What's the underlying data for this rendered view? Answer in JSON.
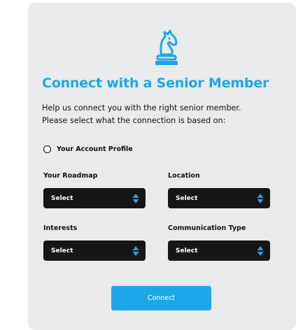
{
  "card": {
    "logo_icon": "chess-knight-icon",
    "title": "Connect with a Senior Member",
    "description_line1": "Help us connect you with the right senior member.",
    "description_line2": "Please select what the connection is based on:"
  },
  "option": {
    "label": "Your Account Profile",
    "selected": false
  },
  "fields": {
    "roadmap": {
      "label": "Your Roadmap",
      "value": "Select"
    },
    "location": {
      "label": "Location",
      "value": "Select"
    },
    "interests": {
      "label": "Interests",
      "value": "Select"
    },
    "communication": {
      "label": "Communication Type",
      "value": "Select"
    }
  },
  "button": {
    "label": "Connect"
  },
  "colors": {
    "accent": "#1ea7e8",
    "card_bg": "#e9eaec",
    "select_bg": "#161616"
  }
}
